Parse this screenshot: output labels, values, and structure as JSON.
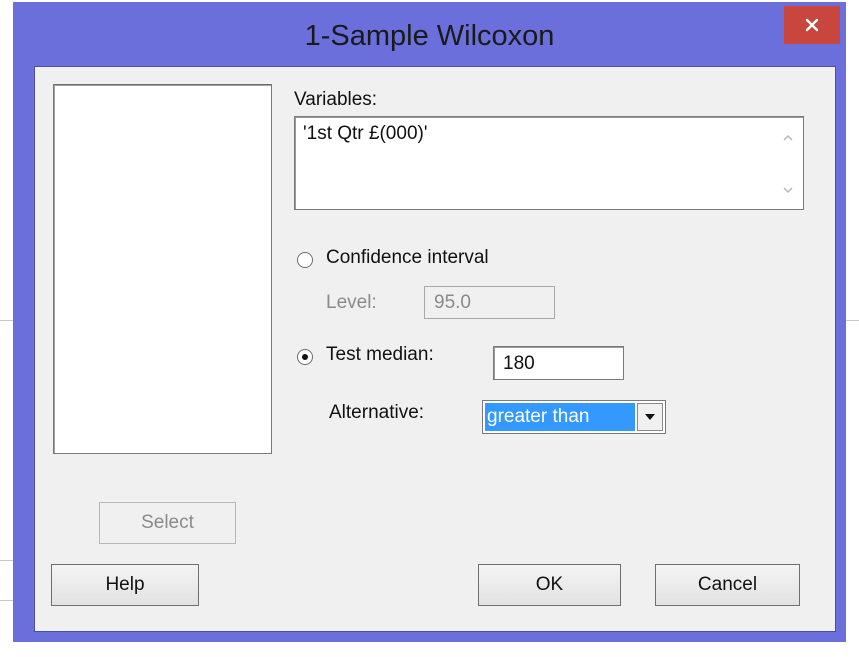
{
  "window": {
    "title": "1-Sample Wilcoxon"
  },
  "form": {
    "variables_label": "Variables:",
    "variables_value": "'1st Qtr £(000)'",
    "confidence_interval_label": "Confidence interval",
    "level_label": "Level:",
    "level_value": "95.0",
    "test_median_label": "Test median:",
    "test_median_value": "180",
    "alternative_label": "Alternative:",
    "alternative_value": "greater than"
  },
  "buttons": {
    "select": "Select",
    "help": "Help",
    "ok": "OK",
    "cancel": "Cancel"
  },
  "icons": {
    "close": "close-icon",
    "scroll_up": "scroll-up-icon",
    "scroll_down": "scroll-down-icon",
    "dropdown": "chevron-down-icon"
  },
  "colors": {
    "titlebar": "#6b6fdb",
    "close_button": "#c8463d",
    "selection": "#3399ff"
  }
}
